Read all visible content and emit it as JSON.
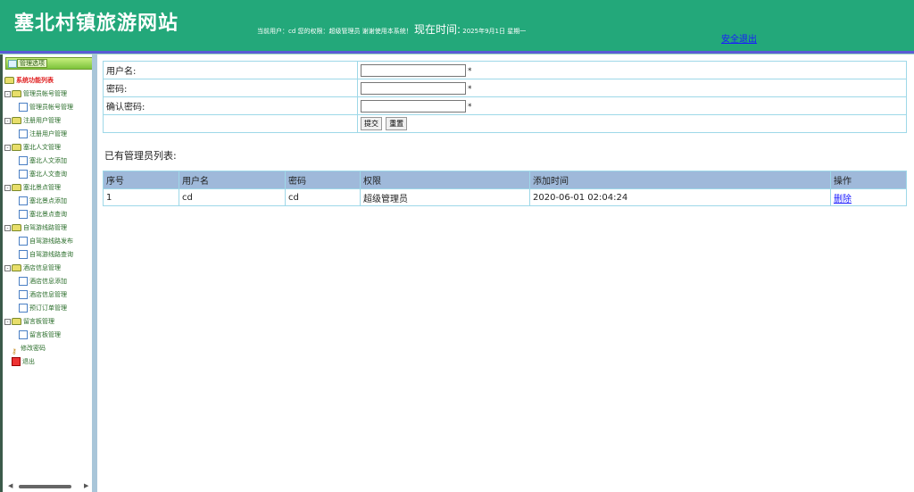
{
  "header": {
    "site_title": "塞北村镇旅游网站",
    "user_info": "当前用户：cd 您的权限：超级管理员 谢谢使用本系统！",
    "time_label": "现在时间:",
    "time_value": "2025年9月1日 星期一",
    "logout": "安全退出"
  },
  "sidebar": {
    "manage_button": "管理选项",
    "root": "系统功能列表",
    "groups": [
      {
        "label": "管理员帐号管理",
        "items": [
          "管理员帐号管理"
        ]
      },
      {
        "label": "注册用户管理",
        "items": [
          "注册用户管理"
        ]
      },
      {
        "label": "塞北人文管理",
        "items": [
          "塞北人文添加",
          "塞北人文查询"
        ]
      },
      {
        "label": "塞北景点管理",
        "items": [
          "塞北景点添加",
          "塞北景点查询"
        ]
      },
      {
        "label": "自驾游线路管理",
        "items": [
          "自驾游线路发布",
          "自驾游线路查询"
        ]
      },
      {
        "label": "酒店信息管理",
        "items": [
          "酒店信息添加",
          "酒店信息管理",
          "预订订单管理"
        ]
      },
      {
        "label": "留言板管理",
        "items": [
          "留言板管理"
        ]
      }
    ],
    "change_password": "修改密码",
    "exit": "退出"
  },
  "form": {
    "username_label": "用户名:",
    "password_label": "密码:",
    "confirm_label": "确认密码:",
    "required_mark": "*",
    "submit": "提交",
    "reset": "重置"
  },
  "list": {
    "title": "已有管理员列表:",
    "columns": [
      "序号",
      "用户名",
      "密码",
      "权限",
      "添加时间",
      "操作"
    ],
    "rows": [
      {
        "index": "1",
        "username": "cd",
        "password": "cd",
        "role": "超级管理员",
        "added": "2020-06-01 02:04:24",
        "action": "删除"
      }
    ]
  },
  "colors": {
    "header_bg": "#23a87a",
    "table_header_bg": "#9fb9da",
    "table_border": "#9ed8e8",
    "link": "#1a1aff"
  }
}
